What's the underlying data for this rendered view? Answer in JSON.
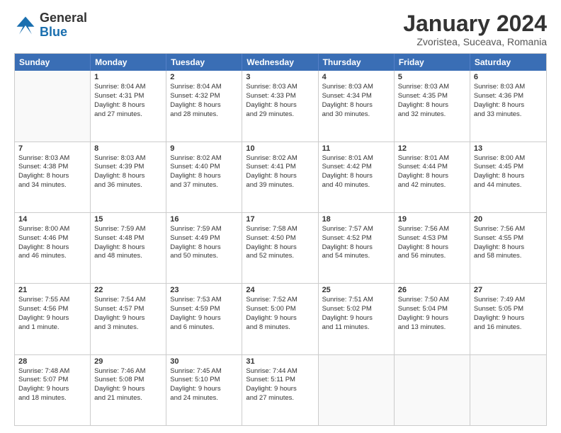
{
  "logo": {
    "general": "General",
    "blue": "Blue"
  },
  "title": "January 2024",
  "subtitle": "Zvoristea, Suceava, Romania",
  "header_days": [
    "Sunday",
    "Monday",
    "Tuesday",
    "Wednesday",
    "Thursday",
    "Friday",
    "Saturday"
  ],
  "weeks": [
    [
      {
        "day": "",
        "lines": [],
        "empty": true
      },
      {
        "day": "1",
        "lines": [
          "Sunrise: 8:04 AM",
          "Sunset: 4:31 PM",
          "Daylight: 8 hours",
          "and 27 minutes."
        ]
      },
      {
        "day": "2",
        "lines": [
          "Sunrise: 8:04 AM",
          "Sunset: 4:32 PM",
          "Daylight: 8 hours",
          "and 28 minutes."
        ]
      },
      {
        "day": "3",
        "lines": [
          "Sunrise: 8:03 AM",
          "Sunset: 4:33 PM",
          "Daylight: 8 hours",
          "and 29 minutes."
        ]
      },
      {
        "day": "4",
        "lines": [
          "Sunrise: 8:03 AM",
          "Sunset: 4:34 PM",
          "Daylight: 8 hours",
          "and 30 minutes."
        ]
      },
      {
        "day": "5",
        "lines": [
          "Sunrise: 8:03 AM",
          "Sunset: 4:35 PM",
          "Daylight: 8 hours",
          "and 32 minutes."
        ]
      },
      {
        "day": "6",
        "lines": [
          "Sunrise: 8:03 AM",
          "Sunset: 4:36 PM",
          "Daylight: 8 hours",
          "and 33 minutes."
        ]
      }
    ],
    [
      {
        "day": "7",
        "lines": [
          "Sunrise: 8:03 AM",
          "Sunset: 4:38 PM",
          "Daylight: 8 hours",
          "and 34 minutes."
        ]
      },
      {
        "day": "8",
        "lines": [
          "Sunrise: 8:03 AM",
          "Sunset: 4:39 PM",
          "Daylight: 8 hours",
          "and 36 minutes."
        ]
      },
      {
        "day": "9",
        "lines": [
          "Sunrise: 8:02 AM",
          "Sunset: 4:40 PM",
          "Daylight: 8 hours",
          "and 37 minutes."
        ]
      },
      {
        "day": "10",
        "lines": [
          "Sunrise: 8:02 AM",
          "Sunset: 4:41 PM",
          "Daylight: 8 hours",
          "and 39 minutes."
        ]
      },
      {
        "day": "11",
        "lines": [
          "Sunrise: 8:01 AM",
          "Sunset: 4:42 PM",
          "Daylight: 8 hours",
          "and 40 minutes."
        ]
      },
      {
        "day": "12",
        "lines": [
          "Sunrise: 8:01 AM",
          "Sunset: 4:44 PM",
          "Daylight: 8 hours",
          "and 42 minutes."
        ]
      },
      {
        "day": "13",
        "lines": [
          "Sunrise: 8:00 AM",
          "Sunset: 4:45 PM",
          "Daylight: 8 hours",
          "and 44 minutes."
        ]
      }
    ],
    [
      {
        "day": "14",
        "lines": [
          "Sunrise: 8:00 AM",
          "Sunset: 4:46 PM",
          "Daylight: 8 hours",
          "and 46 minutes."
        ]
      },
      {
        "day": "15",
        "lines": [
          "Sunrise: 7:59 AM",
          "Sunset: 4:48 PM",
          "Daylight: 8 hours",
          "and 48 minutes."
        ]
      },
      {
        "day": "16",
        "lines": [
          "Sunrise: 7:59 AM",
          "Sunset: 4:49 PM",
          "Daylight: 8 hours",
          "and 50 minutes."
        ]
      },
      {
        "day": "17",
        "lines": [
          "Sunrise: 7:58 AM",
          "Sunset: 4:50 PM",
          "Daylight: 8 hours",
          "and 52 minutes."
        ]
      },
      {
        "day": "18",
        "lines": [
          "Sunrise: 7:57 AM",
          "Sunset: 4:52 PM",
          "Daylight: 8 hours",
          "and 54 minutes."
        ]
      },
      {
        "day": "19",
        "lines": [
          "Sunrise: 7:56 AM",
          "Sunset: 4:53 PM",
          "Daylight: 8 hours",
          "and 56 minutes."
        ]
      },
      {
        "day": "20",
        "lines": [
          "Sunrise: 7:56 AM",
          "Sunset: 4:55 PM",
          "Daylight: 8 hours",
          "and 58 minutes."
        ]
      }
    ],
    [
      {
        "day": "21",
        "lines": [
          "Sunrise: 7:55 AM",
          "Sunset: 4:56 PM",
          "Daylight: 9 hours",
          "and 1 minute."
        ]
      },
      {
        "day": "22",
        "lines": [
          "Sunrise: 7:54 AM",
          "Sunset: 4:57 PM",
          "Daylight: 9 hours",
          "and 3 minutes."
        ]
      },
      {
        "day": "23",
        "lines": [
          "Sunrise: 7:53 AM",
          "Sunset: 4:59 PM",
          "Daylight: 9 hours",
          "and 6 minutes."
        ]
      },
      {
        "day": "24",
        "lines": [
          "Sunrise: 7:52 AM",
          "Sunset: 5:00 PM",
          "Daylight: 9 hours",
          "and 8 minutes."
        ]
      },
      {
        "day": "25",
        "lines": [
          "Sunrise: 7:51 AM",
          "Sunset: 5:02 PM",
          "Daylight: 9 hours",
          "and 11 minutes."
        ]
      },
      {
        "day": "26",
        "lines": [
          "Sunrise: 7:50 AM",
          "Sunset: 5:04 PM",
          "Daylight: 9 hours",
          "and 13 minutes."
        ]
      },
      {
        "day": "27",
        "lines": [
          "Sunrise: 7:49 AM",
          "Sunset: 5:05 PM",
          "Daylight: 9 hours",
          "and 16 minutes."
        ]
      }
    ],
    [
      {
        "day": "28",
        "lines": [
          "Sunrise: 7:48 AM",
          "Sunset: 5:07 PM",
          "Daylight: 9 hours",
          "and 18 minutes."
        ]
      },
      {
        "day": "29",
        "lines": [
          "Sunrise: 7:46 AM",
          "Sunset: 5:08 PM",
          "Daylight: 9 hours",
          "and 21 minutes."
        ]
      },
      {
        "day": "30",
        "lines": [
          "Sunrise: 7:45 AM",
          "Sunset: 5:10 PM",
          "Daylight: 9 hours",
          "and 24 minutes."
        ]
      },
      {
        "day": "31",
        "lines": [
          "Sunrise: 7:44 AM",
          "Sunset: 5:11 PM",
          "Daylight: 9 hours",
          "and 27 minutes."
        ]
      },
      {
        "day": "",
        "lines": [],
        "empty": true
      },
      {
        "day": "",
        "lines": [],
        "empty": true
      },
      {
        "day": "",
        "lines": [],
        "empty": true
      }
    ]
  ]
}
